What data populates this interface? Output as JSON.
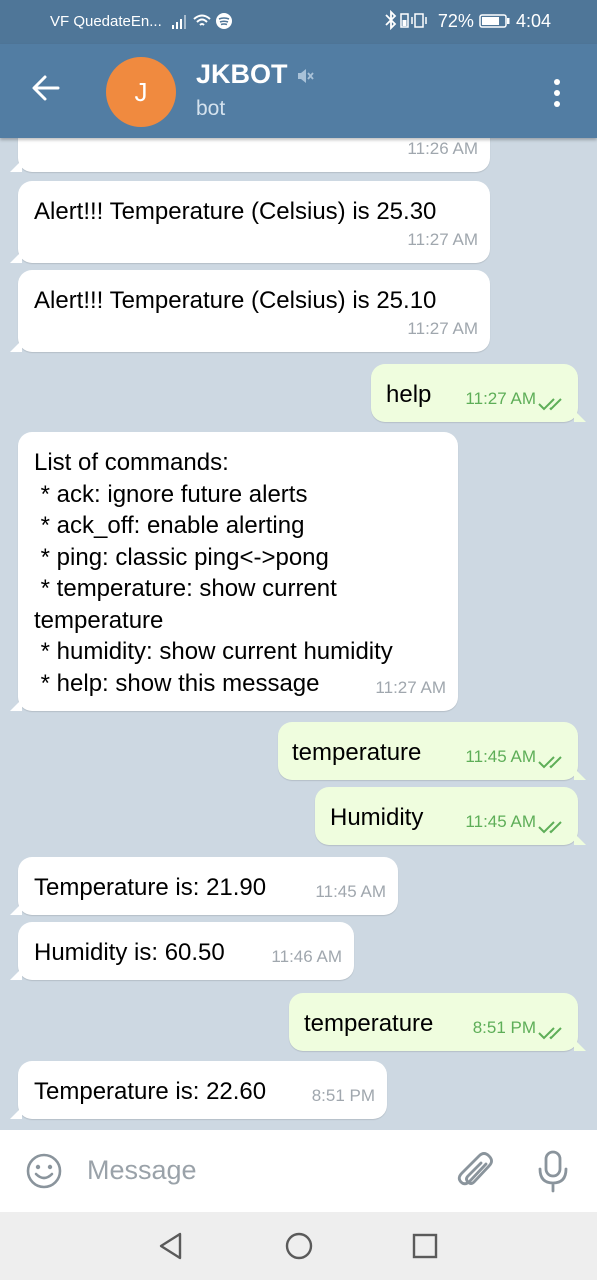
{
  "status_bar": {
    "carrier": "VF QuedateEn...",
    "battery": "72%",
    "time": "4:04"
  },
  "header": {
    "avatar_letter": "J",
    "title": "JKBOT",
    "subtitle": "bot"
  },
  "messages": [
    {
      "direction": "in",
      "text": "",
      "time": "11:26 AM"
    },
    {
      "direction": "in",
      "text": "Alert!!! Temperature (Celsius) is 25.30",
      "time": "11:27 AM"
    },
    {
      "direction": "in",
      "text": "Alert!!! Temperature (Celsius) is 25.10",
      "time": "11:27 AM"
    },
    {
      "direction": "out",
      "text": "help",
      "time": "11:27 AM",
      "read": true
    },
    {
      "direction": "in",
      "text": "List of commands:\n * ack: ignore future alerts\n * ack_off: enable alerting\n * ping: classic ping<->pong\n * temperature: show current\ntemperature\n * humidity: show current humidity\n * help: show this message",
      "time": "11:27 AM"
    },
    {
      "direction": "out",
      "text": "temperature",
      "time": "11:45 AM",
      "read": true
    },
    {
      "direction": "out",
      "text": "Humidity",
      "time": "11:45 AM",
      "read": true
    },
    {
      "direction": "in",
      "text": "Temperature is: 21.90",
      "time": "11:45 AM"
    },
    {
      "direction": "in",
      "text": "Humidity is: 60.50",
      "time": "11:46 AM"
    },
    {
      "direction": "out",
      "text": "temperature",
      "time": "8:51 PM",
      "read": true
    },
    {
      "direction": "in",
      "text": "Temperature is: 22.60",
      "time": "8:51 PM"
    }
  ],
  "composer": {
    "placeholder": "Message"
  },
  "colors": {
    "header": "#527da3",
    "status_bar": "#4f7698",
    "avatar": "#f08a3f",
    "outgoing_bubble": "#effdde",
    "incoming_bubble": "#ffffff",
    "chat_background": "#cdd8e2",
    "read_ticks": "#5eae58"
  }
}
